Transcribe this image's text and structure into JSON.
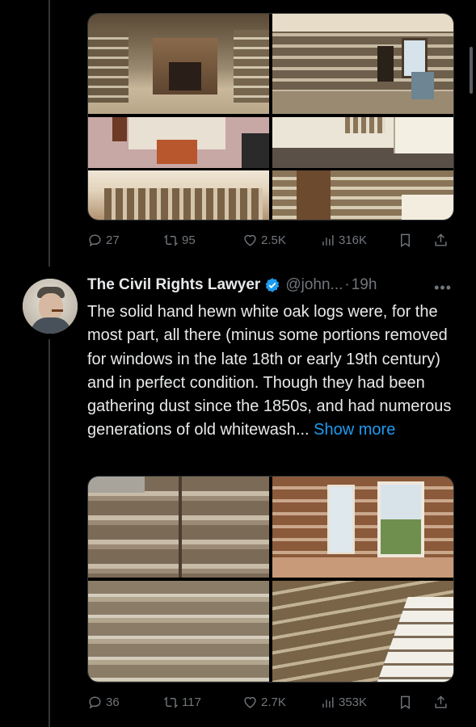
{
  "tweet1": {
    "replies": "27",
    "retweets": "95",
    "likes": "2.5K",
    "views": "316K"
  },
  "tweet2": {
    "author_name": "The Civil Rights Lawyer",
    "handle": "@john...",
    "separator": "·",
    "time": "19h",
    "more": "•••",
    "text": "The solid hand hewn white oak logs were, for the most part, all there (minus some portions removed for windows in the late 18th or early 19th century) and in perfect condition. Though they had been gathering dust since the 1850s, and had numerous generations of old whitewash...",
    "show_more": "Show more",
    "replies": "36",
    "retweets": "117",
    "likes": "2.7K",
    "views": "353K"
  },
  "colors": {
    "background": "#000000",
    "text": "#e7e9ea",
    "muted": "#71767b",
    "link": "#1d9bf0",
    "verified": "#1d9bf0"
  },
  "icons": [
    "reply-icon",
    "retweet-icon",
    "like-icon",
    "views-icon",
    "bookmark-icon",
    "share-icon",
    "verified-badge-icon"
  ]
}
